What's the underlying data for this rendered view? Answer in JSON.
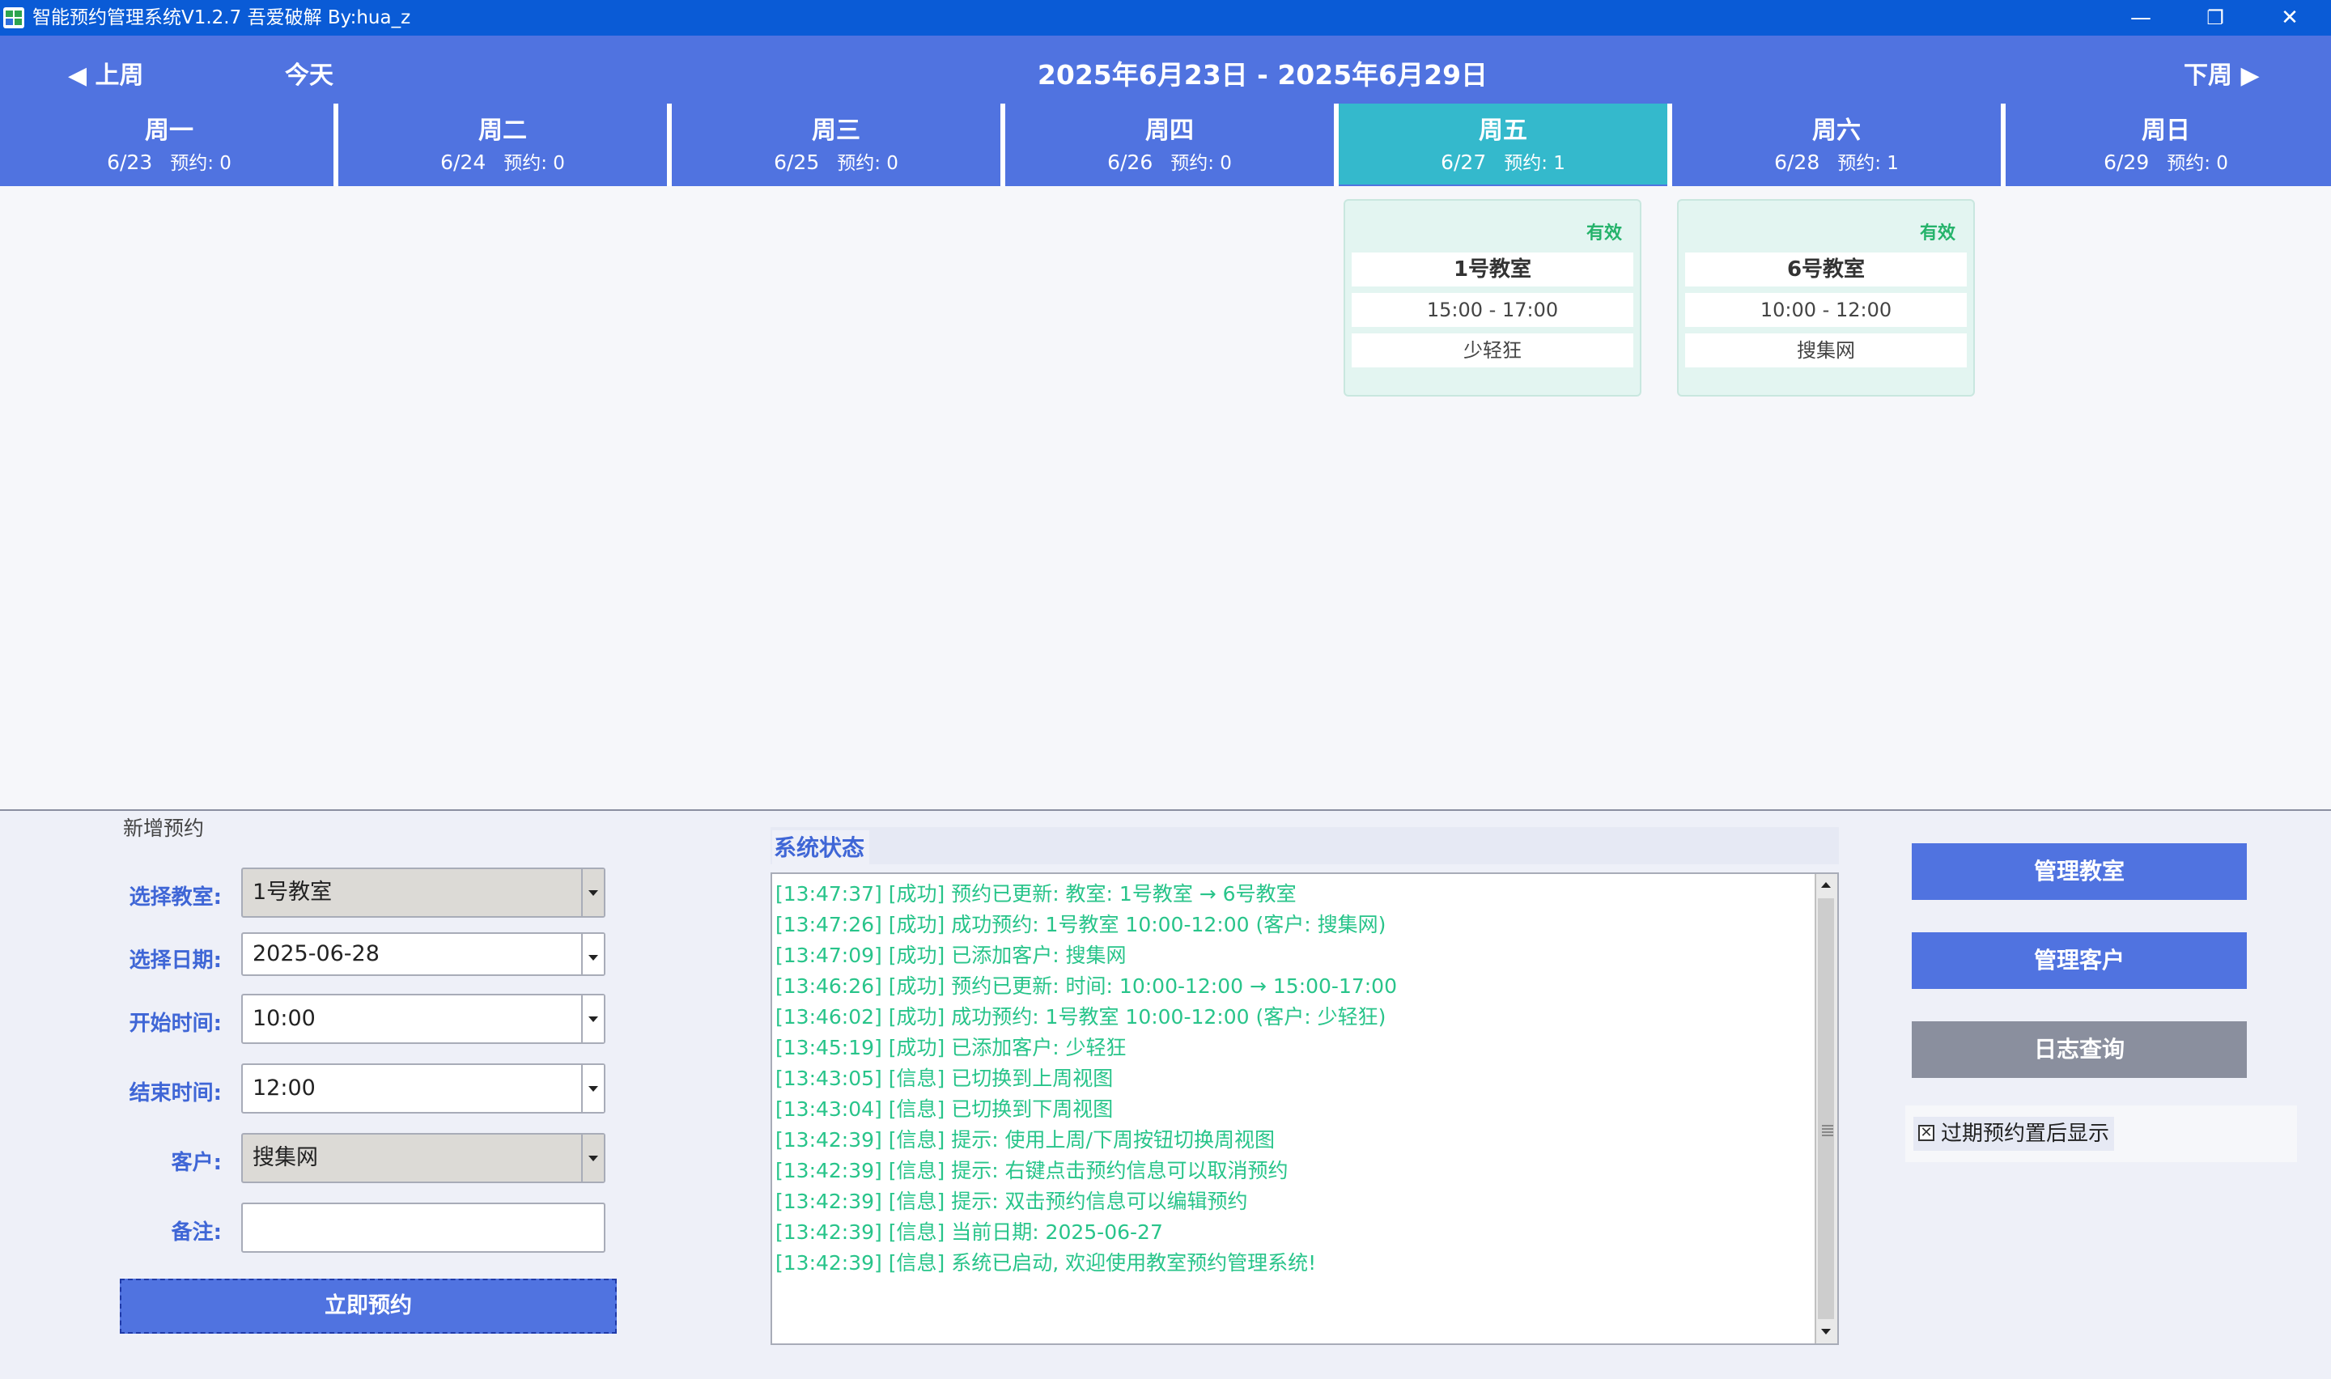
{
  "window": {
    "title": "智能预约管理系统V1.2.7 吾爱破解 By:hua_z",
    "minimize_glyph": "—",
    "restore_glyph": "❐",
    "close_glyph": "✕"
  },
  "week_nav": {
    "prev_label": "◀ 上周",
    "today_label": "今天",
    "range": "2025年6月23日 - 2025年6月29日",
    "next_label": "下周 ▶"
  },
  "days": [
    {
      "name": "周一",
      "date": "6/23",
      "count": "预约: 0"
    },
    {
      "name": "周二",
      "date": "6/24",
      "count": "预约: 0"
    },
    {
      "name": "周三",
      "date": "6/25",
      "count": "预约: 0"
    },
    {
      "name": "周四",
      "date": "6/26",
      "count": "预约: 0"
    },
    {
      "name": "周五",
      "date": "6/27",
      "count": "预约: 1"
    },
    {
      "name": "周六",
      "date": "6/28",
      "count": "预约: 1"
    },
    {
      "name": "周日",
      "date": "6/29",
      "count": "预约: 0"
    }
  ],
  "bookings": [
    {
      "status": "有效",
      "room": "1号教室",
      "time": "15:00 - 17:00",
      "customer": "少轻狂"
    },
    {
      "status": "有效",
      "room": "6号教室",
      "time": "10:00 - 12:00",
      "customer": "搜集网"
    }
  ],
  "form": {
    "group_title": "新增预约",
    "room_label": "选择教室:",
    "room_value": "1号教室",
    "date_label": "选择日期:",
    "date_value": "2025-06-28",
    "start_label": "开始时间:",
    "start_value": "10:00",
    "end_label": "结束时间:",
    "end_value": "12:00",
    "customer_label": "客户:",
    "customer_value": "搜集网",
    "note_label": "备注:",
    "note_value": "",
    "submit_label": "立即预约"
  },
  "status_panel": {
    "title": "系统状态",
    "logs": [
      "[13:47:37] [成功] 预约已更新: 教室: 1号教室 → 6号教室",
      "[13:47:26] [成功] 成功预约: 1号教室 10:00-12:00 (客户: 搜集网)",
      "[13:47:09] [成功] 已添加客户: 搜集网",
      "[13:46:26] [成功] 预约已更新: 时间: 10:00-12:00 → 15:00-17:00",
      "[13:46:02] [成功] 成功预约: 1号教室 10:00-12:00 (客户: 少轻狂)",
      "[13:45:19] [成功] 已添加客户: 少轻狂",
      "[13:43:05] [信息] 已切换到上周视图",
      "[13:43:04] [信息] 已切换到下周视图",
      "[13:42:39] [信息] 提示: 使用上周/下周按钮切换周视图",
      "[13:42:39] [信息] 提示: 右键点击预约信息可以取消预约",
      "[13:42:39] [信息] 提示: 双击预约信息可以编辑预约",
      "[13:42:39] [信息] 当前日期: 2025-06-27",
      "[13:42:39] [信息] 系统已启动, 欢迎使用教室预约管理系统!"
    ]
  },
  "actions": {
    "manage_rooms": "管理教室",
    "manage_customers": "管理客户",
    "log_query": "日志查询",
    "expired_last_label": "过期预约置后显示",
    "expired_last_checked": true
  },
  "colors": {
    "header_blue": "#5073e0",
    "selected_day": "#34b9cc",
    "titlebar": "#0a5bd6",
    "valid_green": "#25b36b",
    "log_green": "#28c48a",
    "gray_button": "#8a8f9e"
  },
  "icons": {
    "app": "app-grid-icon",
    "prev": "triangle-left-icon",
    "next": "triangle-right-icon",
    "checkbox": "checkbox-x-icon"
  }
}
